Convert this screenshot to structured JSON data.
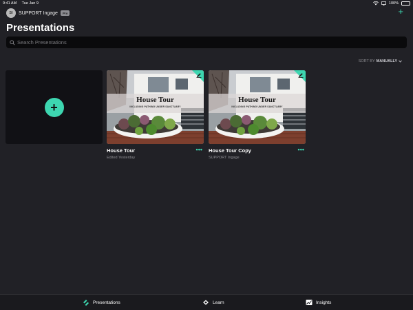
{
  "status": {
    "time": "9:41 AM",
    "date": "Tue Jan 9",
    "battery": "100%",
    "battery_level": 1.0
  },
  "account": {
    "initials": "SI",
    "name": "SUPPORT Ingage",
    "badge": "Pro"
  },
  "header": {
    "title": "Presentations",
    "add_label": "+"
  },
  "search": {
    "placeholder": "Search Presentations",
    "value": ""
  },
  "sort": {
    "prefix": "SORT BY",
    "value": "MANUALLY"
  },
  "new_card": {
    "label": "+"
  },
  "presentations": [
    {
      "name": "House Tour",
      "subtitle": "Edited Yesterday",
      "thumb_title": "House Tour",
      "thumb_subtitle": "INCLUDING PATHING UNDER SANCTUARY",
      "more": "•••"
    },
    {
      "name": "House Tour Copy",
      "subtitle": "SUPPORT Ingage",
      "thumb_title": "House Tour",
      "thumb_subtitle": "INCLUDING PATHING UNDER SANCTUARY",
      "more": "•••"
    }
  ],
  "tabs": [
    {
      "label": "Presentations",
      "icon": "presentations-icon"
    },
    {
      "label": "Learn",
      "icon": "learn-icon"
    },
    {
      "label": "Insights",
      "icon": "insights-icon"
    }
  ],
  "colors": {
    "accent": "#3dd6b0",
    "background": "#212126",
    "card": "#111115"
  }
}
